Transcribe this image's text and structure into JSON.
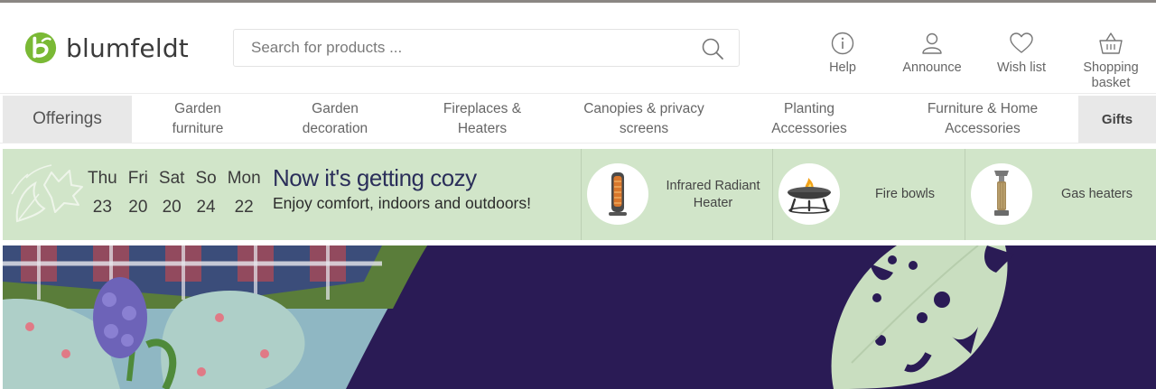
{
  "brand": {
    "name": "blumfeldt",
    "color": "#7ab935"
  },
  "search": {
    "placeholder": "Search for products ..."
  },
  "header_actions": [
    {
      "icon": "info-icon",
      "label": "Help"
    },
    {
      "icon": "user-icon",
      "label": "Announce"
    },
    {
      "icon": "heart-icon",
      "label": "Wish list"
    },
    {
      "icon": "basket-icon",
      "label": "Shopping basket"
    }
  ],
  "nav": {
    "offerings": "Offerings",
    "items": [
      "Garden furniture",
      "Garden decoration",
      "Fireplaces & Heaters",
      "Canopies & privacy screens",
      "Planting Accessories",
      "Furniture & Home Accessories"
    ],
    "gifts": "Gifts"
  },
  "promo": {
    "days": [
      {
        "name": "Thu",
        "num": "23"
      },
      {
        "name": "Fri",
        "num": "20"
      },
      {
        "name": "Sat",
        "num": "20"
      },
      {
        "name": "So",
        "num": "24"
      },
      {
        "name": "Mon",
        "num": "22"
      }
    ],
    "title": "Now it's getting cozy",
    "subtitle": "Enjoy comfort, indoors and outdoors!",
    "cards": [
      {
        "image": "infrared-heater-icon",
        "label": "Infrared Radiant Heater"
      },
      {
        "image": "fire-bowl-icon",
        "label": "Fire bowls"
      },
      {
        "image": "gas-heater-icon",
        "label": "Gas heaters"
      }
    ],
    "background_color": "#d1e5c9"
  },
  "hero": {
    "background_color": "#2a1b55",
    "leaf_color": "#c9dec0"
  }
}
